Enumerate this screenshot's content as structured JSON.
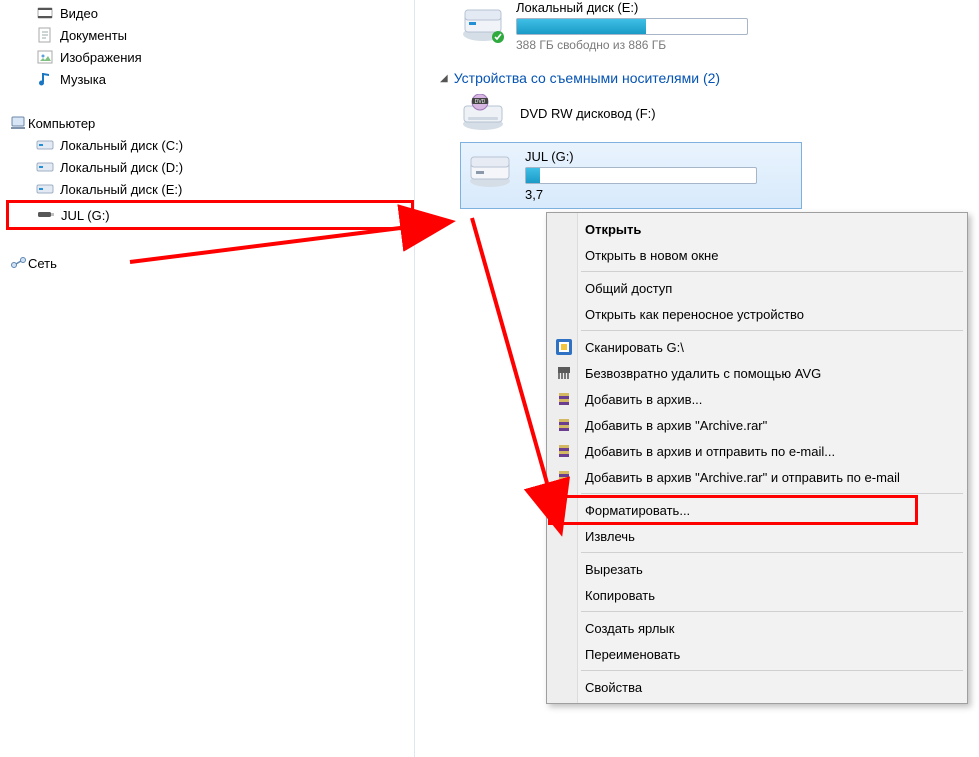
{
  "left": {
    "libraries": [
      {
        "icon": "video",
        "label": "Видео"
      },
      {
        "icon": "doc",
        "label": "Документы"
      },
      {
        "icon": "image",
        "label": "Изображения"
      },
      {
        "icon": "music",
        "label": "Музыка"
      }
    ],
    "computer_label": "Компьютер",
    "drives": [
      {
        "label": "Локальный диск (C:)"
      },
      {
        "label": "Локальный диск (D:)"
      },
      {
        "label": "Локальный диск (E:)"
      }
    ],
    "jul_label": "JUL (G:)",
    "network_label": "Сеть"
  },
  "right": {
    "drive_e": {
      "title": "Локальный диск (E:)",
      "free_text": "388 ГБ свободно из 886 ГБ",
      "fill_pct": 56
    },
    "removable_header": "Устройства со съемными носителями (2)",
    "dvd_label": "DVD RW дисковод (F:)",
    "jul": {
      "title": "JUL (G:)",
      "sub": "3,7",
      "fill_pct": 6
    }
  },
  "context_menu": {
    "groups": [
      [
        {
          "label": "Открыть",
          "bold": true
        },
        {
          "label": "Открыть в новом окне"
        }
      ],
      [
        {
          "label": "Общий доступ"
        },
        {
          "label": "Открыть как переносное устройство"
        }
      ],
      [
        {
          "label": "Сканировать G:\\",
          "icon": "avg"
        },
        {
          "label": "Безвозвратно удалить с помощью AVG",
          "icon": "shred"
        },
        {
          "label": "Добавить в архив...",
          "icon": "rar"
        },
        {
          "label": "Добавить в архив \"Archive.rar\"",
          "icon": "rar"
        },
        {
          "label": "Добавить в архив и отправить по e-mail...",
          "icon": "rar"
        },
        {
          "label": "Добавить в архив \"Archive.rar\" и отправить по e-mail",
          "icon": "rar"
        }
      ],
      [
        {
          "label": "Форматировать...",
          "highlight": true
        },
        {
          "label": "Извлечь"
        }
      ],
      [
        {
          "label": "Вырезать"
        },
        {
          "label": "Копировать"
        }
      ],
      [
        {
          "label": "Создать ярлык"
        },
        {
          "label": "Переименовать"
        }
      ],
      [
        {
          "label": "Свойства"
        }
      ]
    ]
  }
}
